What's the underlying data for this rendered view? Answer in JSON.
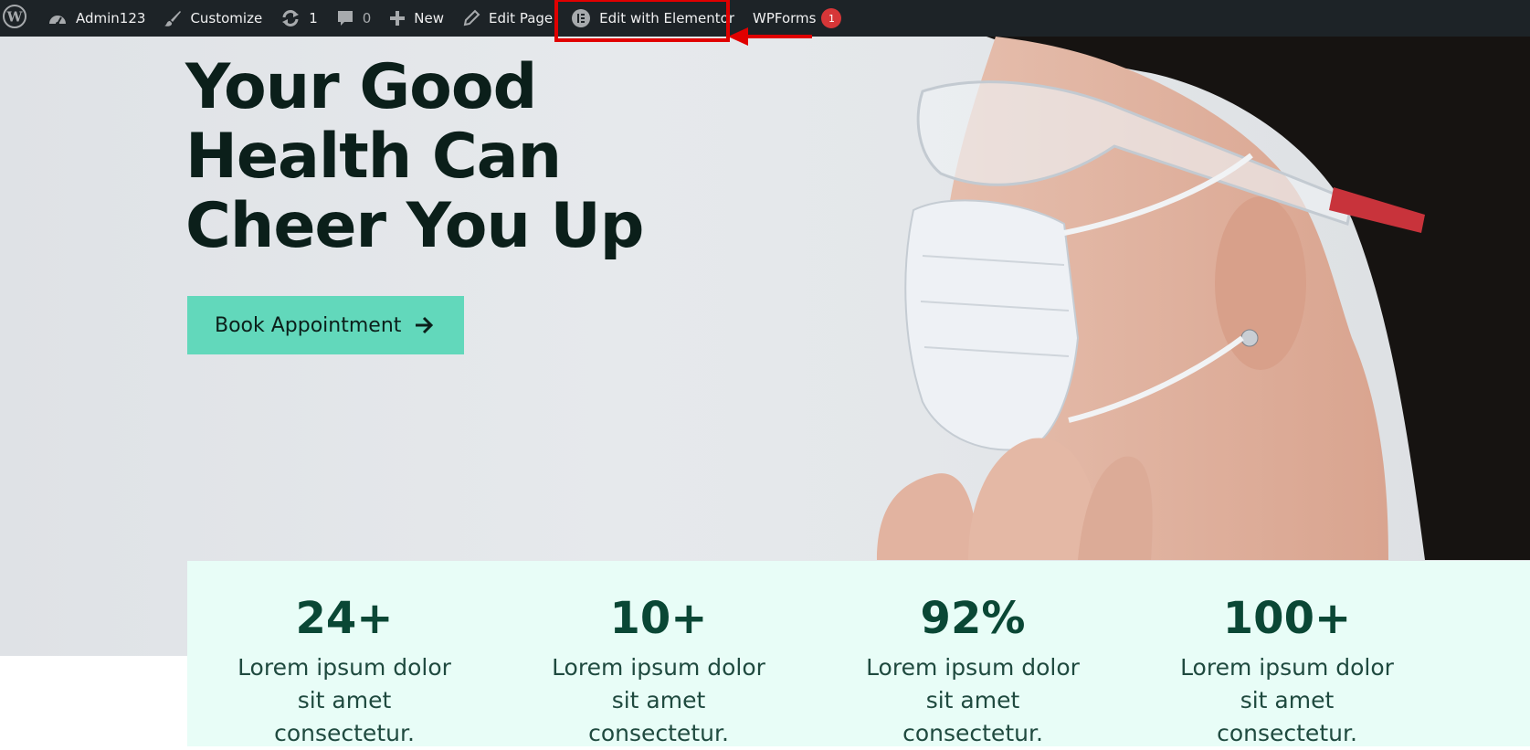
{
  "admin_bar": {
    "site_label": "Admin123",
    "customize_label": "Customize",
    "updates_count": "1",
    "comments_count": "0",
    "new_label": "New",
    "edit_page_label": "Edit Page",
    "elementor_label": "Edit with Elementor",
    "wpforms_label": "WPForms",
    "wpforms_badge": "1",
    "highlight_color": "#e00000"
  },
  "hero": {
    "title_line1": "Your Good",
    "title_line2": "Health Can",
    "title_line3": "Cheer You Up",
    "cta_label": "Book Appointment",
    "cta_color": "#62d8bb"
  },
  "stats": [
    {
      "value": "24+",
      "label": "Lorem ipsum dolor sit amet consectetur."
    },
    {
      "value": "10+",
      "label": "Lorem ipsum dolor sit amet consectetur."
    },
    {
      "value": "92%",
      "label": "Lorem ipsum dolor sit amet consectetur."
    },
    {
      "value": "100+",
      "label": "Lorem ipsum dolor sit amet consectetur."
    }
  ],
  "icons": [
    "wordpress-logo-icon",
    "dashboard-icon",
    "brush-icon",
    "updates-icon",
    "comment-icon",
    "plus-icon",
    "pencil-icon",
    "elementor-icon",
    "arrow-right-icon"
  ]
}
